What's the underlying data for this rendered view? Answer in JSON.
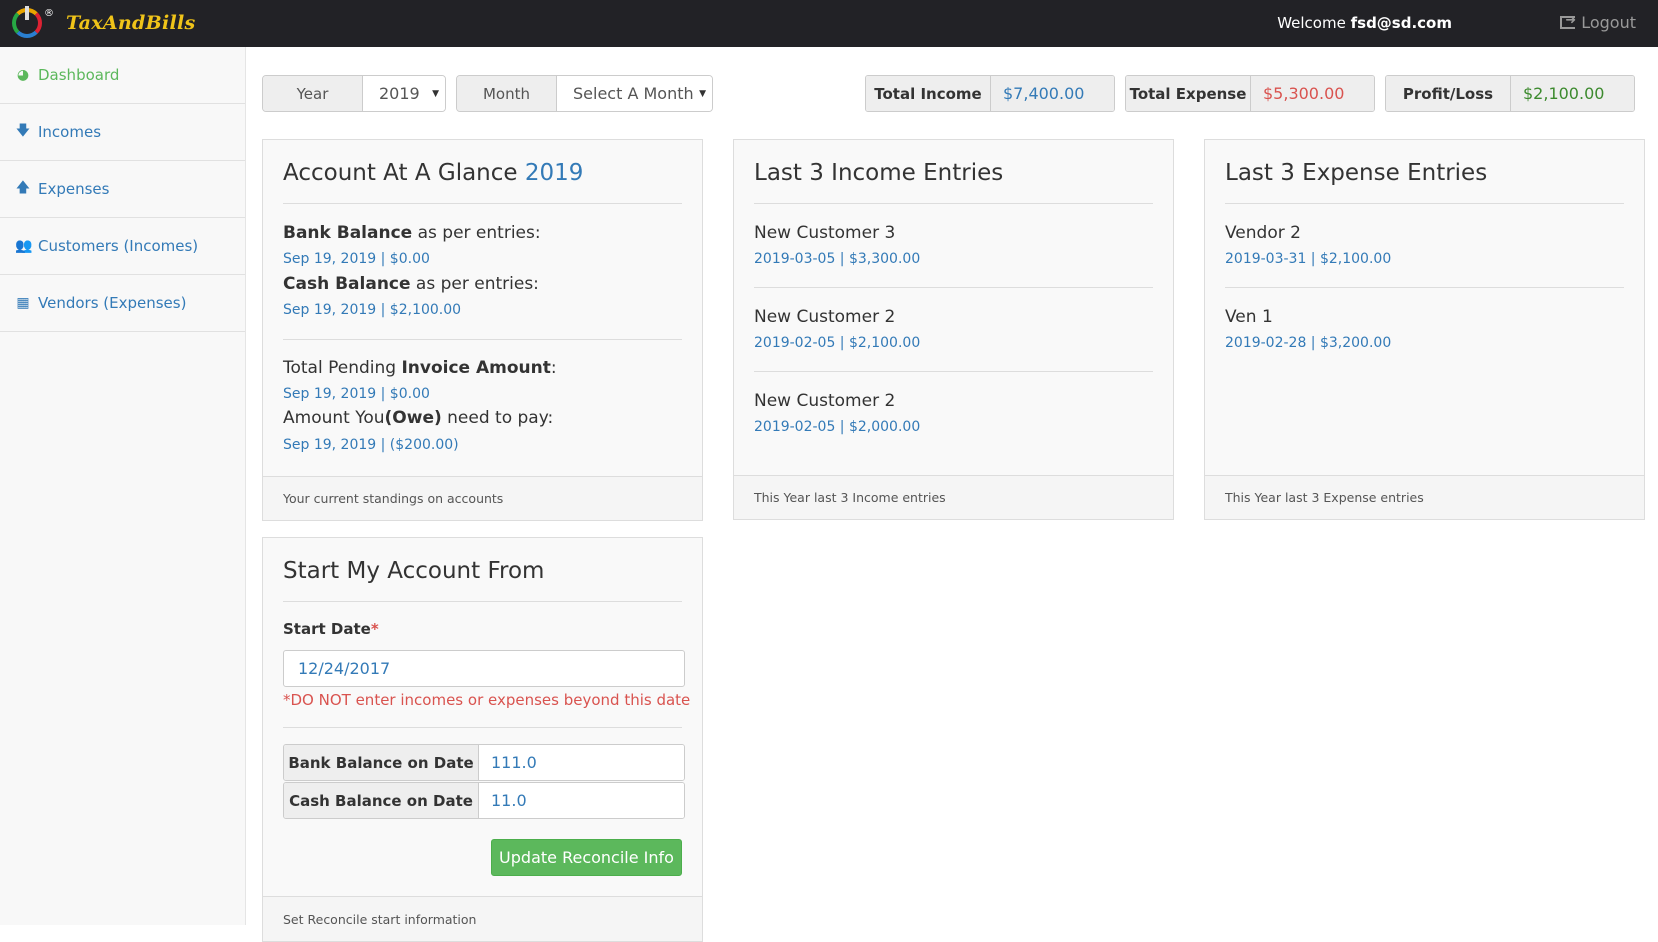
{
  "header": {
    "brand": "TaxAndBills",
    "brand_reg": "®",
    "welcome_prefix": "Welcome",
    "user": "fsd@sd.com",
    "logout": "Logout"
  },
  "sidebar": {
    "items": [
      {
        "label": "Dashboard",
        "icon": "dashboard-icon",
        "active": true
      },
      {
        "label": "Incomes",
        "icon": "arrow-down-icon"
      },
      {
        "label": "Expenses",
        "icon": "arrow-up-icon"
      },
      {
        "label": "Customers (Incomes)",
        "icon": "users-icon"
      },
      {
        "label": "Vendors (Expenses)",
        "icon": "building-icon"
      }
    ]
  },
  "filters": {
    "year_label": "Year",
    "year_value": "2019",
    "month_label": "Month",
    "month_value": "Select A Month"
  },
  "stats": {
    "income_label": "Total Income",
    "income_value": "$7,400.00",
    "expense_label": "Total Expense",
    "expense_value": "$5,300.00",
    "profit_label": "Profit/Loss",
    "profit_value": "$2,100.00"
  },
  "glance": {
    "title": "Account At A Glance",
    "year": "2019",
    "bank_bold": "Bank Balance",
    "bank_rest": " as per entries:",
    "bank_value": "Sep 19, 2019 | $0.00",
    "cash_bold": "Cash Balance",
    "cash_rest": " as per entries:",
    "cash_value": "Sep 19, 2019 | $2,100.00",
    "pending_pre": "Total Pending ",
    "pending_bold": "Invoice Amount",
    "pending_post": ":",
    "pending_value": "Sep 19, 2019 | $0.00",
    "owe_pre": "Amount You",
    "owe_bold": "(Owe)",
    "owe_post": " need to pay:",
    "owe_value": "Sep 19, 2019 | ($200.00)",
    "footer": "Your current standings on accounts"
  },
  "income": {
    "title": "Last 3 Income Entries",
    "entries": [
      {
        "name": "New Customer 3",
        "detail": "2019-03-05 | $3,300.00"
      },
      {
        "name": "New Customer 2",
        "detail": "2019-02-05 | $2,100.00"
      },
      {
        "name": "New Customer 2",
        "detail": "2019-02-05 | $2,000.00"
      }
    ],
    "footer": "This Year last 3 Income entries"
  },
  "expense": {
    "title": "Last 3 Expense Entries",
    "entries": [
      {
        "name": "Vendor 2",
        "detail": "2019-03-31 | $2,100.00"
      },
      {
        "name": "Ven 1",
        "detail": "2019-02-28 | $3,200.00"
      }
    ],
    "footer": "This Year last 3 Expense entries"
  },
  "start": {
    "title": "Start My Account From",
    "date_label": "Start Date",
    "required_mark": "*",
    "date_value": "12/24/2017",
    "warning": "*DO NOT enter incomes or expenses beyond this date",
    "bank_label": "Bank Balance on Date",
    "bank_value": "111.0",
    "cash_label": "Cash Balance on Date",
    "cash_value": "11.0",
    "button": "Update Reconcile Info",
    "footer": "Set Reconcile start information"
  },
  "colors": {
    "income": "#337ab7",
    "expense": "#d9534f",
    "profit": "#3c8a2e",
    "active": "#5cb85c"
  }
}
